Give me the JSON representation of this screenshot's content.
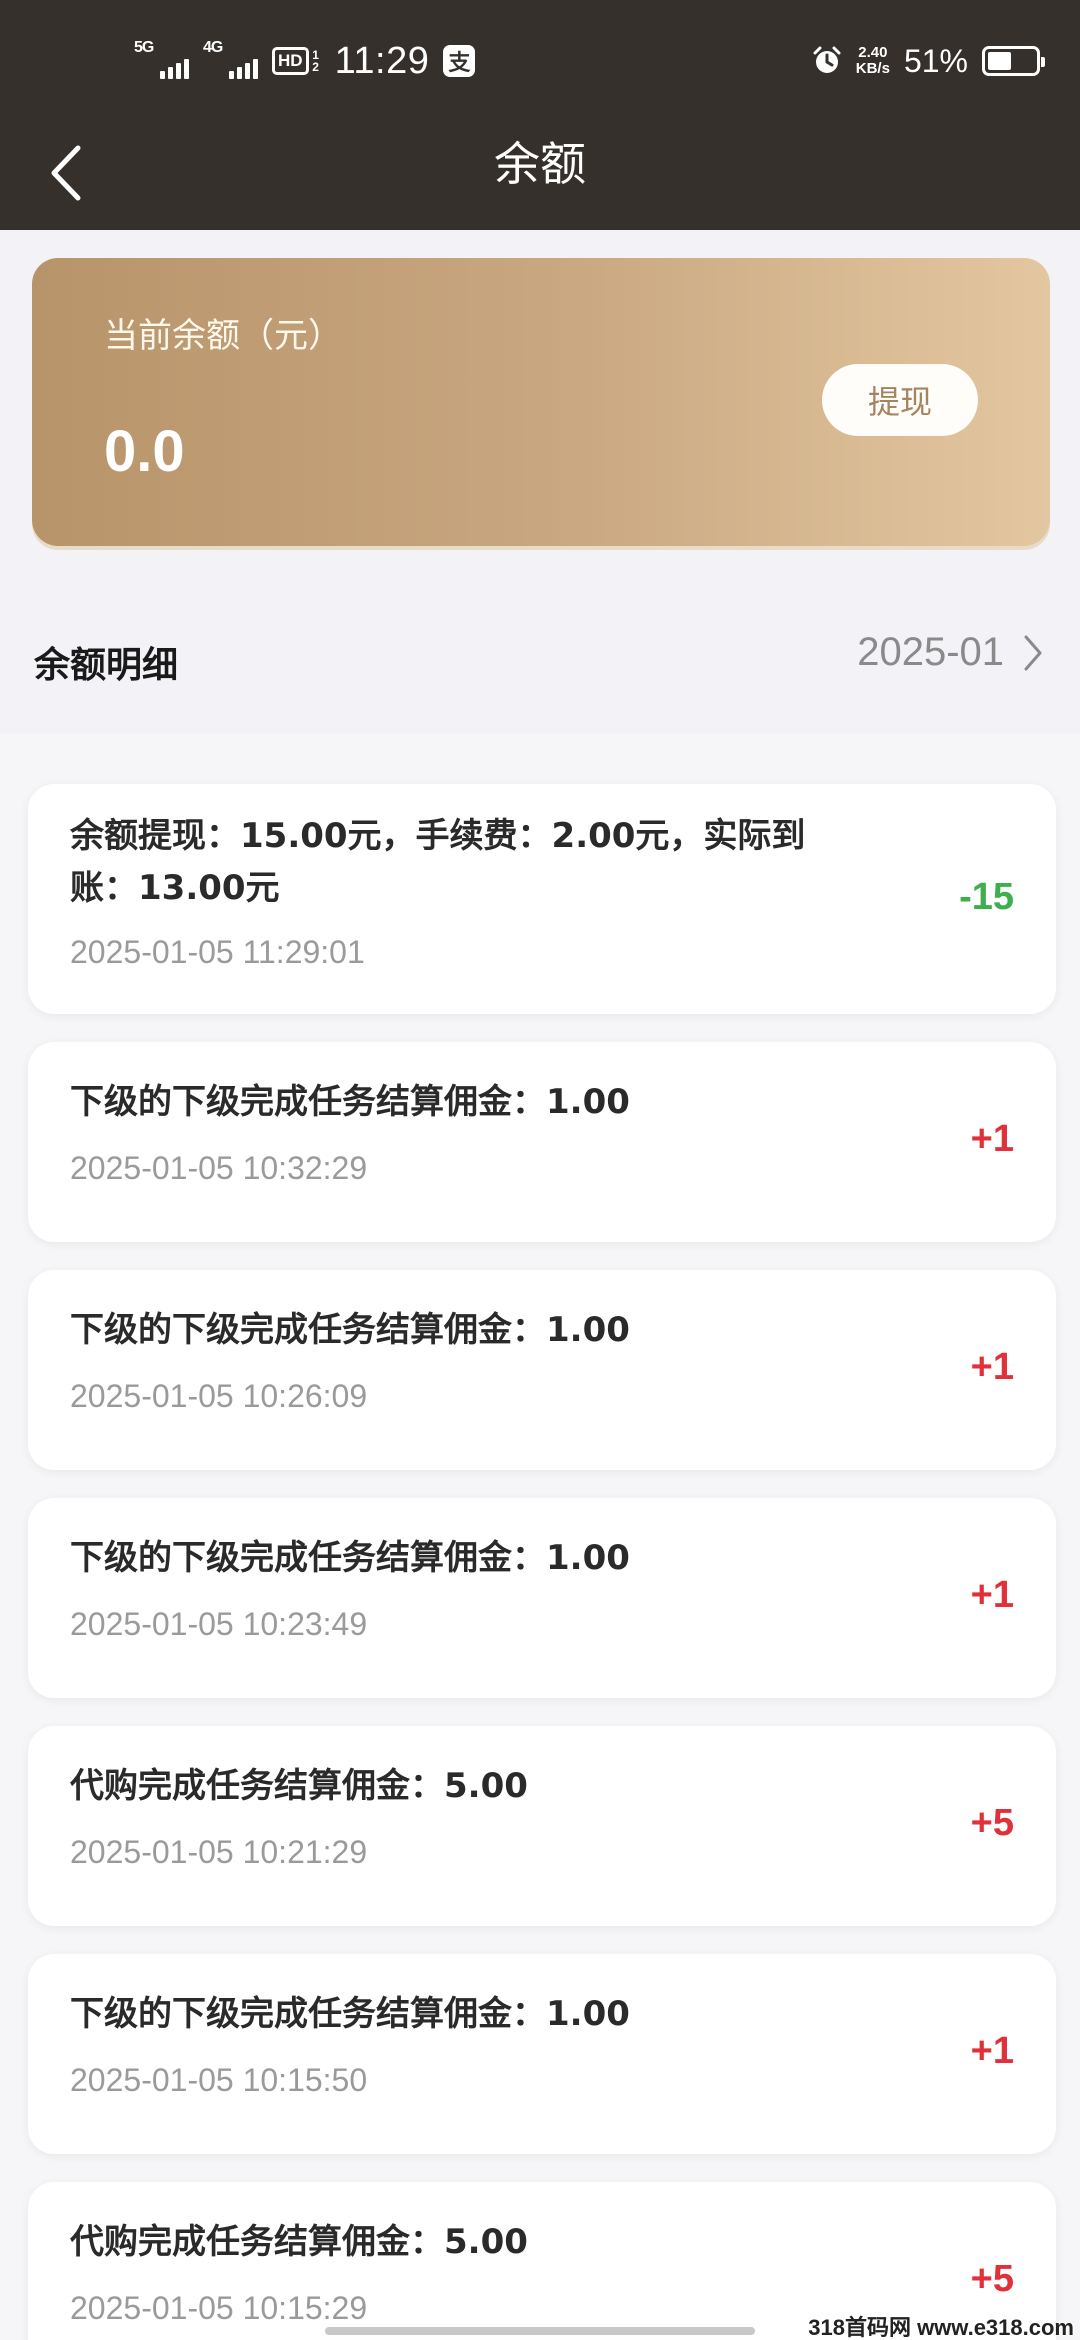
{
  "status_bar": {
    "network_1": "5G",
    "network_2": "4G",
    "hd_label": "HD",
    "hd_sub": "1 2",
    "time": "11:29",
    "pay_icon": "支",
    "net_speed_value": "2.40",
    "net_speed_unit": "KB/s",
    "battery_percent": "51%",
    "battery_level": 0.51
  },
  "nav": {
    "title": "余额",
    "back_icon": "chevron-left-icon"
  },
  "balance_card": {
    "label": "当前余额（元）",
    "amount": "0.0",
    "withdraw_label": "提现"
  },
  "details": {
    "title": "余额明细",
    "month": "2025-01"
  },
  "records": [
    {
      "desc": "余额提现：15.00元，手续费：2.00元，实际到账：13.00元",
      "time": "2025-01-05 11:29:01",
      "amount": "-15",
      "sign": "neg"
    },
    {
      "desc": "下级的下级完成任务结算佣金：1.00",
      "time": "2025-01-05 10:32:29",
      "amount": "+1",
      "sign": "pos"
    },
    {
      "desc": "下级的下级完成任务结算佣金：1.00",
      "time": "2025-01-05 10:26:09",
      "amount": "+1",
      "sign": "pos"
    },
    {
      "desc": "下级的下级完成任务结算佣金：1.00",
      "time": "2025-01-05 10:23:49",
      "amount": "+1",
      "sign": "pos"
    },
    {
      "desc": "代购完成任务结算佣金：5.00",
      "time": "2025-01-05 10:21:29",
      "amount": "+5",
      "sign": "pos"
    },
    {
      "desc": "下级的下级完成任务结算佣金：1.00",
      "time": "2025-01-05 10:15:50",
      "amount": "+1",
      "sign": "pos"
    },
    {
      "desc": "代购完成任务结算佣金：5.00",
      "time": "2025-01-05 10:15:29",
      "amount": "+5",
      "sign": "pos"
    }
  ],
  "watermark": "318首码网 www.e318.com",
  "colors": {
    "header_bg": "#35302c",
    "card_gradient_start": "#b8946a",
    "card_gradient_end": "#e3c7a0",
    "negative_amount": "#3fae4e",
    "positive_amount": "#e0303a"
  }
}
